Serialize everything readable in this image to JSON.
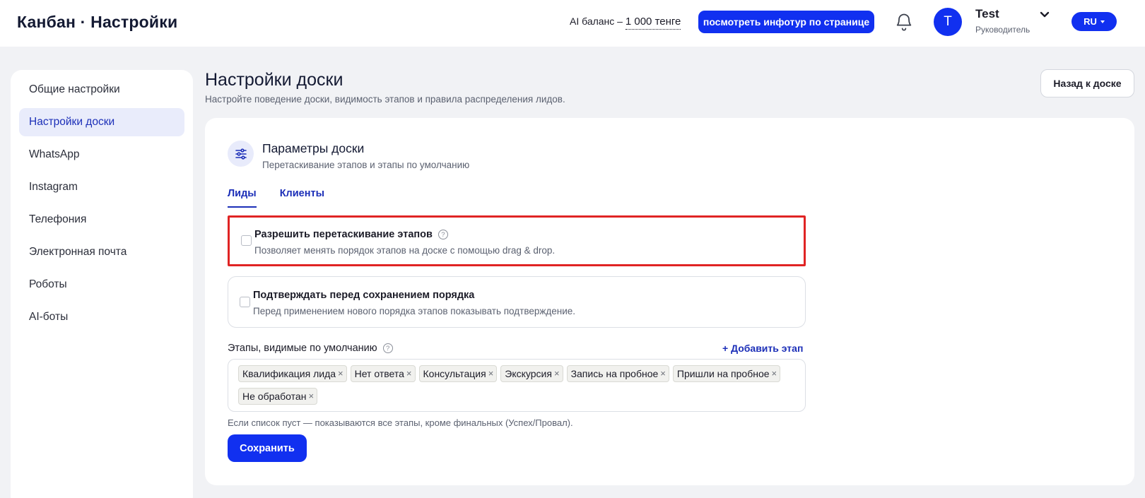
{
  "header": {
    "app_title": "Канбан · Настройки",
    "ai_balance_prefix": "AI баланс – ",
    "ai_balance_amount": "1 000 тенге",
    "tour_button": "посмотреть инфотур по странице",
    "notifications_icon": "bell-icon",
    "user": {
      "avatar_letter": "T",
      "name": "Test",
      "role": "Руководитель"
    },
    "language": "RU",
    "accent_color": "#1130f0"
  },
  "sidebar": {
    "items": [
      {
        "label": "Общие настройки",
        "active": false
      },
      {
        "label": "Настройки доски",
        "active": true
      },
      {
        "label": "WhatsApp",
        "active": false
      },
      {
        "label": "Instagram",
        "active": false
      },
      {
        "label": "Телефония",
        "active": false
      },
      {
        "label": "Электронная почта",
        "active": false
      },
      {
        "label": "Роботы",
        "active": false
      },
      {
        "label": "AI-боты",
        "active": false
      }
    ]
  },
  "page": {
    "title": "Настройки доски",
    "subtitle": "Настройте поведение доски, видимость этапов и правила распределения лидов.",
    "back_button": "Назад к доске"
  },
  "card": {
    "title": "Параметры доски",
    "subtitle": "Перетаскивание этапов и этапы по умолчанию",
    "icon": "sliders-icon",
    "tabs": [
      {
        "label": "Лиды",
        "active": true
      },
      {
        "label": "Клиенты",
        "active": false
      }
    ],
    "options": [
      {
        "title": "Разрешить перетаскивание этапов",
        "description": "Позволяет менять порядок этапов на доске с помощью drag & drop.",
        "checked": false,
        "has_help": true,
        "highlighted": true
      },
      {
        "title": "Подтверждать перед сохранением порядка",
        "description": "Перед применением нового порядка этапов показывать подтверждение.",
        "checked": false,
        "has_help": false,
        "highlighted": false
      }
    ],
    "stages_label": "Этапы, видимые по умолчанию",
    "add_stage": "+ Добавить этап",
    "stages_row1": [
      "Квалификация лида",
      "Нет ответа",
      "Консультация",
      "Экскурсия",
      "Запись на пробное",
      "Пришли на пробное"
    ],
    "stages_row2": [
      "Не обработан"
    ],
    "remove_symbol": "×",
    "hint": "Если список пуст — показываются все этапы, кроме финальных (Успех/Провал).",
    "save_button": "Сохранить"
  }
}
